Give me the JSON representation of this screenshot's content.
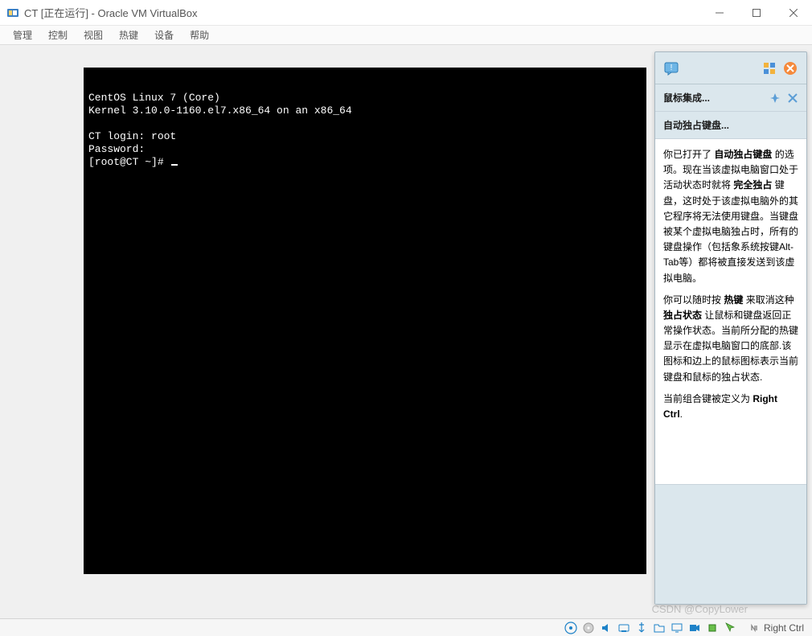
{
  "window": {
    "title": "CT [正在运行] - Oracle VM VirtualBox"
  },
  "menubar": {
    "items": [
      "管理",
      "控制",
      "视图",
      "热键",
      "设备",
      "帮助"
    ]
  },
  "terminal": {
    "line1": "CentOS Linux 7 (Core)",
    "line2": "Kernel 3.10.0-1160.el7.x86_64 on an x86_64",
    "line3": "CT login: root",
    "line4": "Password:",
    "prompt": "[root@CT ~]# "
  },
  "side_panel": {
    "row1_label": "鼠标集成...",
    "row2_label": "自动独占键盘...",
    "body_parts": {
      "p1_a": "你已打开了 ",
      "p1_b_bold": "自动独占键盘",
      "p1_c": " 的选项。现在当该虚拟电脑窗口处于活动状态时就将 ",
      "p1_d_bold": "完全独占",
      "p1_e": " 键盘，这时处于该虚拟电脑外的其它程序将无法使用键盘。当键盘被某个虚拟电脑独占时，所有的键盘操作（包括象系统按键Alt-Tab等）都将被直接发送到该虚拟电脑。",
      "p2_a": "你可以随时按 ",
      "p2_b_bold": "热键",
      "p2_c": " 来取消这种 ",
      "p2_d_bold": "独占状态",
      "p2_e": " 让鼠标和键盘返回正常操作状态。当前所分配的热键显示在虚拟电脑窗口的底部.该图标和边上的鼠标图标表示当前键盘和鼠标的独占状态.",
      "p3_a": "当前组合键被定义为 ",
      "p3_b_bold": "Right Ctrl",
      "p3_c": "."
    }
  },
  "statusbar": {
    "host_key": "Right Ctrl"
  },
  "watermark": "CSDN @CopyLower"
}
